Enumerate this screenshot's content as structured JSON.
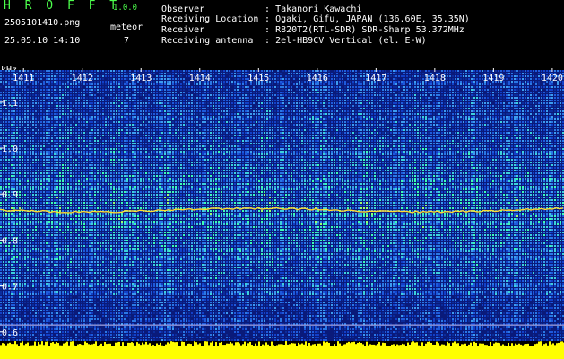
{
  "header": {
    "app_title": "H R O F F T",
    "version": "1.0.0",
    "filename": "2505101410.png",
    "datetime": "25.05.10 14:10",
    "meteor_label": "meteor",
    "meteor_count": "7",
    "info": [
      {
        "label": "Observer",
        "sep": ":",
        "value": "Takanori Kawachi"
      },
      {
        "label": "Receiving Location",
        "sep": ":",
        "value": "Ogaki, Gifu, JAPAN (136.60E, 35.35N)"
      },
      {
        "label": "Receiver",
        "sep": ":",
        "value": "R820T2(RTL-SDR) SDR-Sharp 53.372MHz"
      },
      {
        "label": "Receiving antenna",
        "sep": ":",
        "value": "2el-HB9CV Vertical (el. E-W)"
      }
    ]
  },
  "colors": {
    "background": "#000000",
    "spectrum_base": "#0a1a7a",
    "spectrum_mid": "#1e5adc",
    "spectrum_hot": "#3cffb4",
    "signal_line": "#ffdc32",
    "text_header": "#4cff4c",
    "text_info": "#ffffff",
    "level_bar": "#ffff00",
    "minute_marker": "#00ffff"
  },
  "chart_data": {
    "type": "heatmap",
    "title": "",
    "ylabel": "kHz",
    "xlabel": "",
    "x_ticks": [
      "1411",
      "1412",
      "1413",
      "1414",
      "1415",
      "1416",
      "1417",
      "1418",
      "1419",
      "1420"
    ],
    "y_ticks": [
      "1.1",
      "1.0",
      "0.9",
      "0.8",
      "0.7",
      "0.6"
    ],
    "y_tick_values": [
      1.1,
      1.0,
      0.9,
      0.8,
      0.7,
      0.6
    ],
    "x_range": [
      1410.6,
      1420.2
    ],
    "y_range": [
      0.58,
      1.17
    ],
    "carrier_khz": 0.865,
    "reference_line_khz": 0.615,
    "meteor_count": 7
  }
}
